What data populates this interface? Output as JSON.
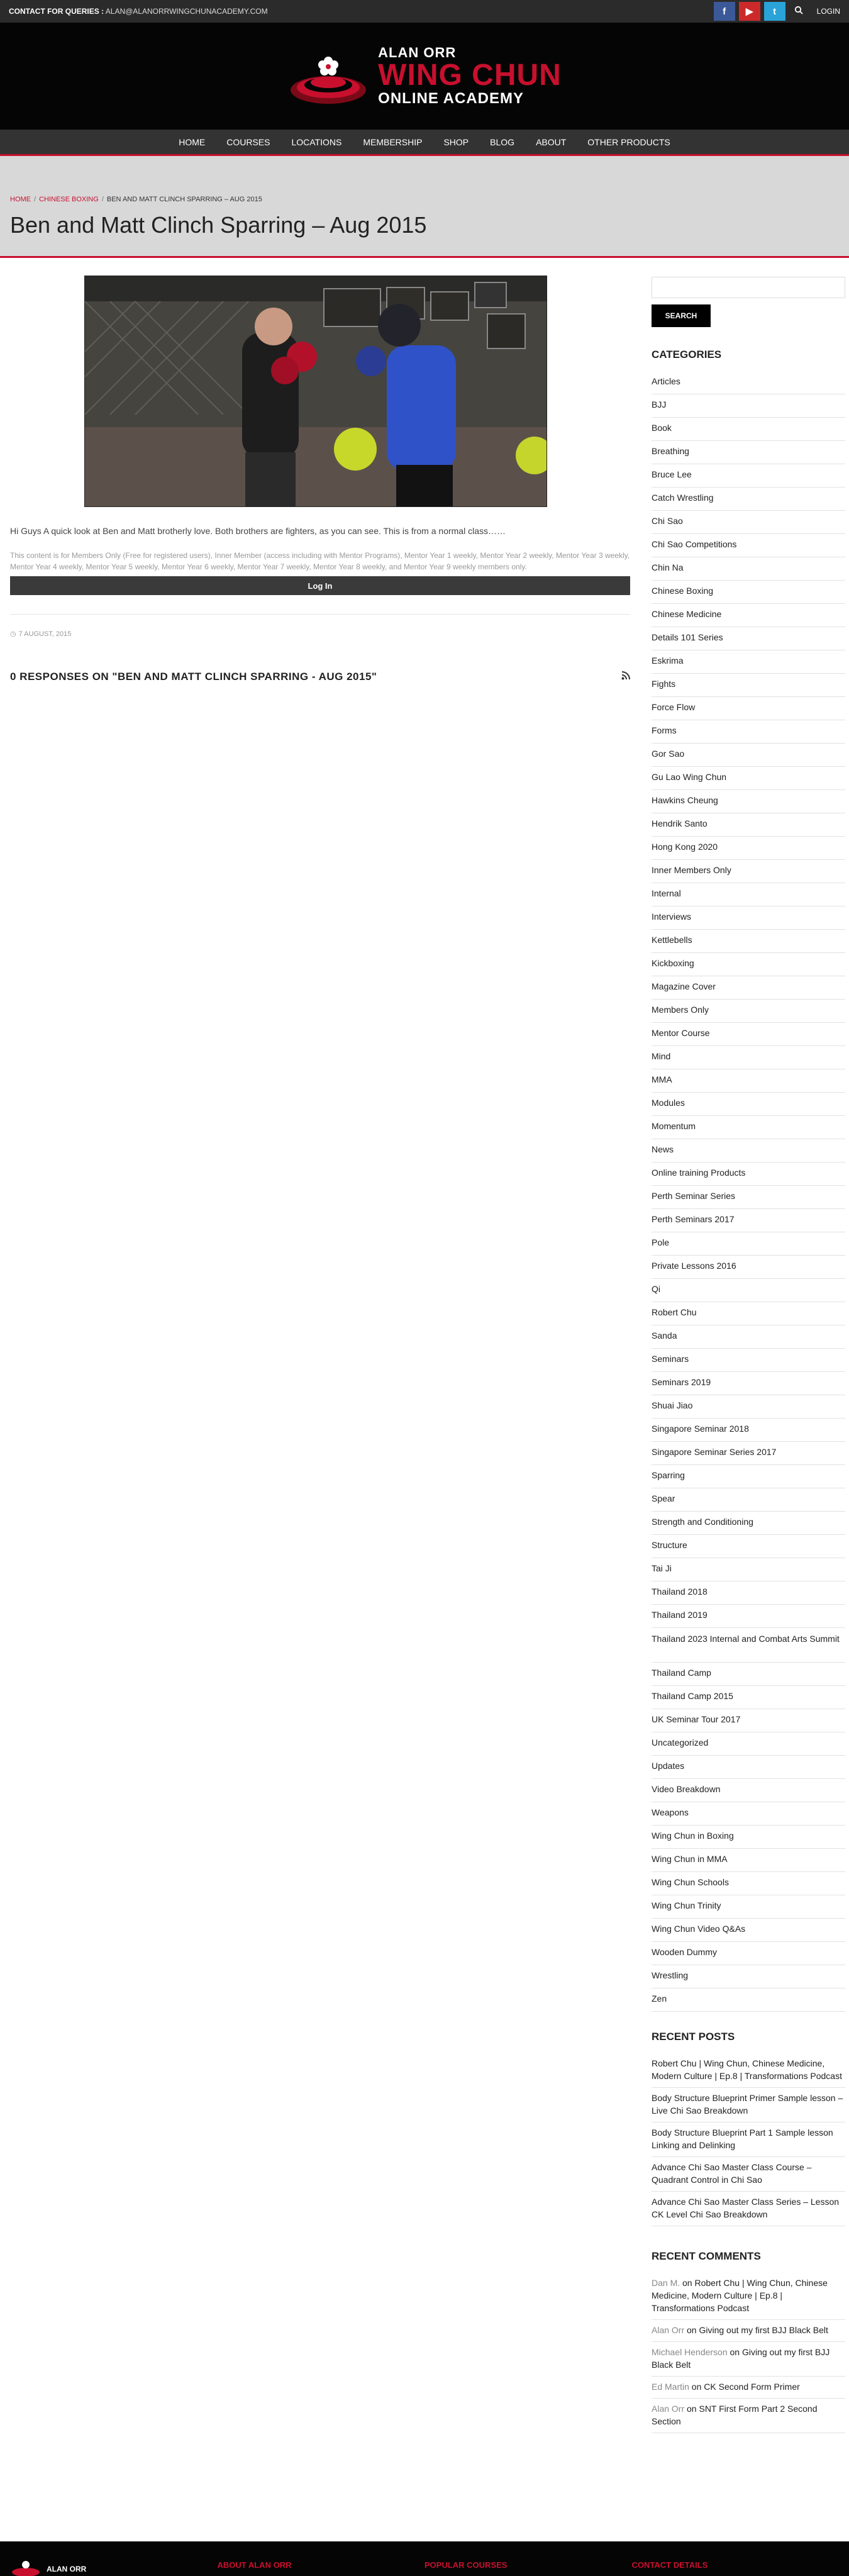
{
  "topbar": {
    "contact_label": "CONTACT FOR QUERIES :",
    "contact_email": "ALAN@ALANORRWINGCHUNACADEMY.COM",
    "facebook": "f",
    "youtube": "▶",
    "twitter": "t",
    "login": "LOGIN"
  },
  "logo": {
    "line1": "ALAN ORR",
    "line2": "WING CHUN",
    "line3": "ONLINE ACADEMY"
  },
  "nav": [
    "HOME",
    "COURSES",
    "LOCATIONS",
    "MEMBERSHIP",
    "SHOP",
    "BLOG",
    "ABOUT",
    "OTHER PRODUCTS"
  ],
  "breadcrumb": {
    "home": "HOME",
    "category": "CHINESE BOXING",
    "current": "BEN AND MATT CLINCH SPARRING – AUG 2015"
  },
  "page_title": "Ben and Matt Clinch Sparring – Aug 2015",
  "post": {
    "text": "Hi Guys A quick look at Ben and Matt brotherly love. Both brothers are fighters, as you can see. This is from a normal class……",
    "restriction": "This content is for Members Only (Free for registered users), Inner Member (access including with Mentor Programs), Mentor Year 1 weekly, Mentor Year 2 weekly, Mentor Year 3 weekly, Mentor Year 4 weekly, Mentor Year 5 weekly, Mentor Year 6 weekly, Mentor Year 7 weekly, Mentor Year 8 weekly, and Mentor Year 9 weekly members only.",
    "login_button": "Log In",
    "date": "7 AUGUST, 2015",
    "responses": "0 RESPONSES ON \"BEN AND MATT CLINCH SPARRING - AUG 2015\""
  },
  "sidebar": {
    "search_button": "SEARCH",
    "categories_title": "CATEGORIES",
    "categories": [
      "Articles",
      "BJJ",
      "Book",
      "Breathing",
      "Bruce Lee",
      "Catch Wrestling",
      "Chi Sao",
      "Chi Sao Competitions",
      "Chin Na",
      "Chinese Boxing",
      "Chinese Medicine",
      "Details 101 Series",
      "Eskrima",
      "Fights",
      "Force Flow",
      "Forms",
      "Gor Sao",
      "Gu Lao Wing Chun",
      "Hawkins Cheung",
      "Hendrik Santo",
      "Hong Kong 2020",
      "Inner Members Only",
      "Internal",
      "Interviews",
      "Kettlebells",
      "Kickboxing",
      "Magazine Cover",
      "Members Only",
      "Mentor Course",
      "Mind",
      "MMA",
      "Modules",
      "Momentum",
      "News",
      "Online training Products",
      "Perth Seminar Series",
      "Perth Seminars 2017",
      "Pole",
      "Private Lessons 2016",
      "Qi",
      "Robert Chu",
      "Sanda",
      "Seminars",
      "Seminars 2019",
      "Shuai Jiao",
      "Singapore Seminar 2018",
      "Singapore Seminar Series 2017",
      "Sparring",
      "Spear",
      "Strength and Conditioning",
      "Structure",
      "Tai Ji",
      "Thailand 2018",
      "Thailand 2019",
      "Thailand 2023 Internal and Combat Arts Summit",
      "Thailand Camp",
      "Thailand Camp 2015",
      "UK Seminar Tour 2017",
      "Uncategorized",
      "Updates",
      "Video Breakdown",
      "Weapons",
      "Wing Chun in Boxing",
      "Wing Chun in MMA",
      "Wing Chun Schools",
      "Wing Chun Trinity",
      "Wing Chun Video Q&As",
      "Wooden Dummy",
      "Wrestling",
      "Zen"
    ],
    "recent_posts_title": "RECENT POSTS",
    "recent_posts": [
      "Robert Chu | Wing Chun, Chinese Medicine, Modern Culture | Ep.8 | Transformations Podcast",
      "Body Structure Blueprint Primer Sample lesson – Live Chi Sao Breakdown",
      "Body Structure Blueprint Part 1 Sample lesson Linking and Delinking",
      "Advance Chi Sao Master Class Course – Quadrant Control in Chi Sao",
      "Advance Chi Sao Master Class Series – Lesson CK Level Chi Sao Breakdown"
    ],
    "recent_comments_title": "RECENT COMMENTS",
    "recent_comments": [
      {
        "author": "Dan M.",
        "on": " on ",
        "post": "Robert Chu | Wing Chun, Chinese Medicine, Modern Culture | Ep.8 | Transformations Podcast"
      },
      {
        "author": "Alan Orr",
        "on": " on ",
        "post": "Giving out my first BJJ Black Belt"
      },
      {
        "author": "Michael Henderson",
        "on": " on ",
        "post": "Giving out my first BJJ Black Belt"
      },
      {
        "author": "Ed Martin",
        "on": " on ",
        "post": "CK Second Form Primer"
      },
      {
        "author": "Alan Orr",
        "on": " on ",
        "post": "SNT First Form Part 2 Second Section"
      }
    ]
  },
  "footer": {
    "logo_text": "ALAN ORR",
    "about": "ABOUT ALAN ORR",
    "popular": "POPULAR COURSES",
    "contact": "CONTACT DETAILS"
  },
  "colors": {
    "accent": "#c8102e",
    "nav_bg": "#333333",
    "header_bg": "#050505",
    "title_band": "#d8d8d8"
  }
}
